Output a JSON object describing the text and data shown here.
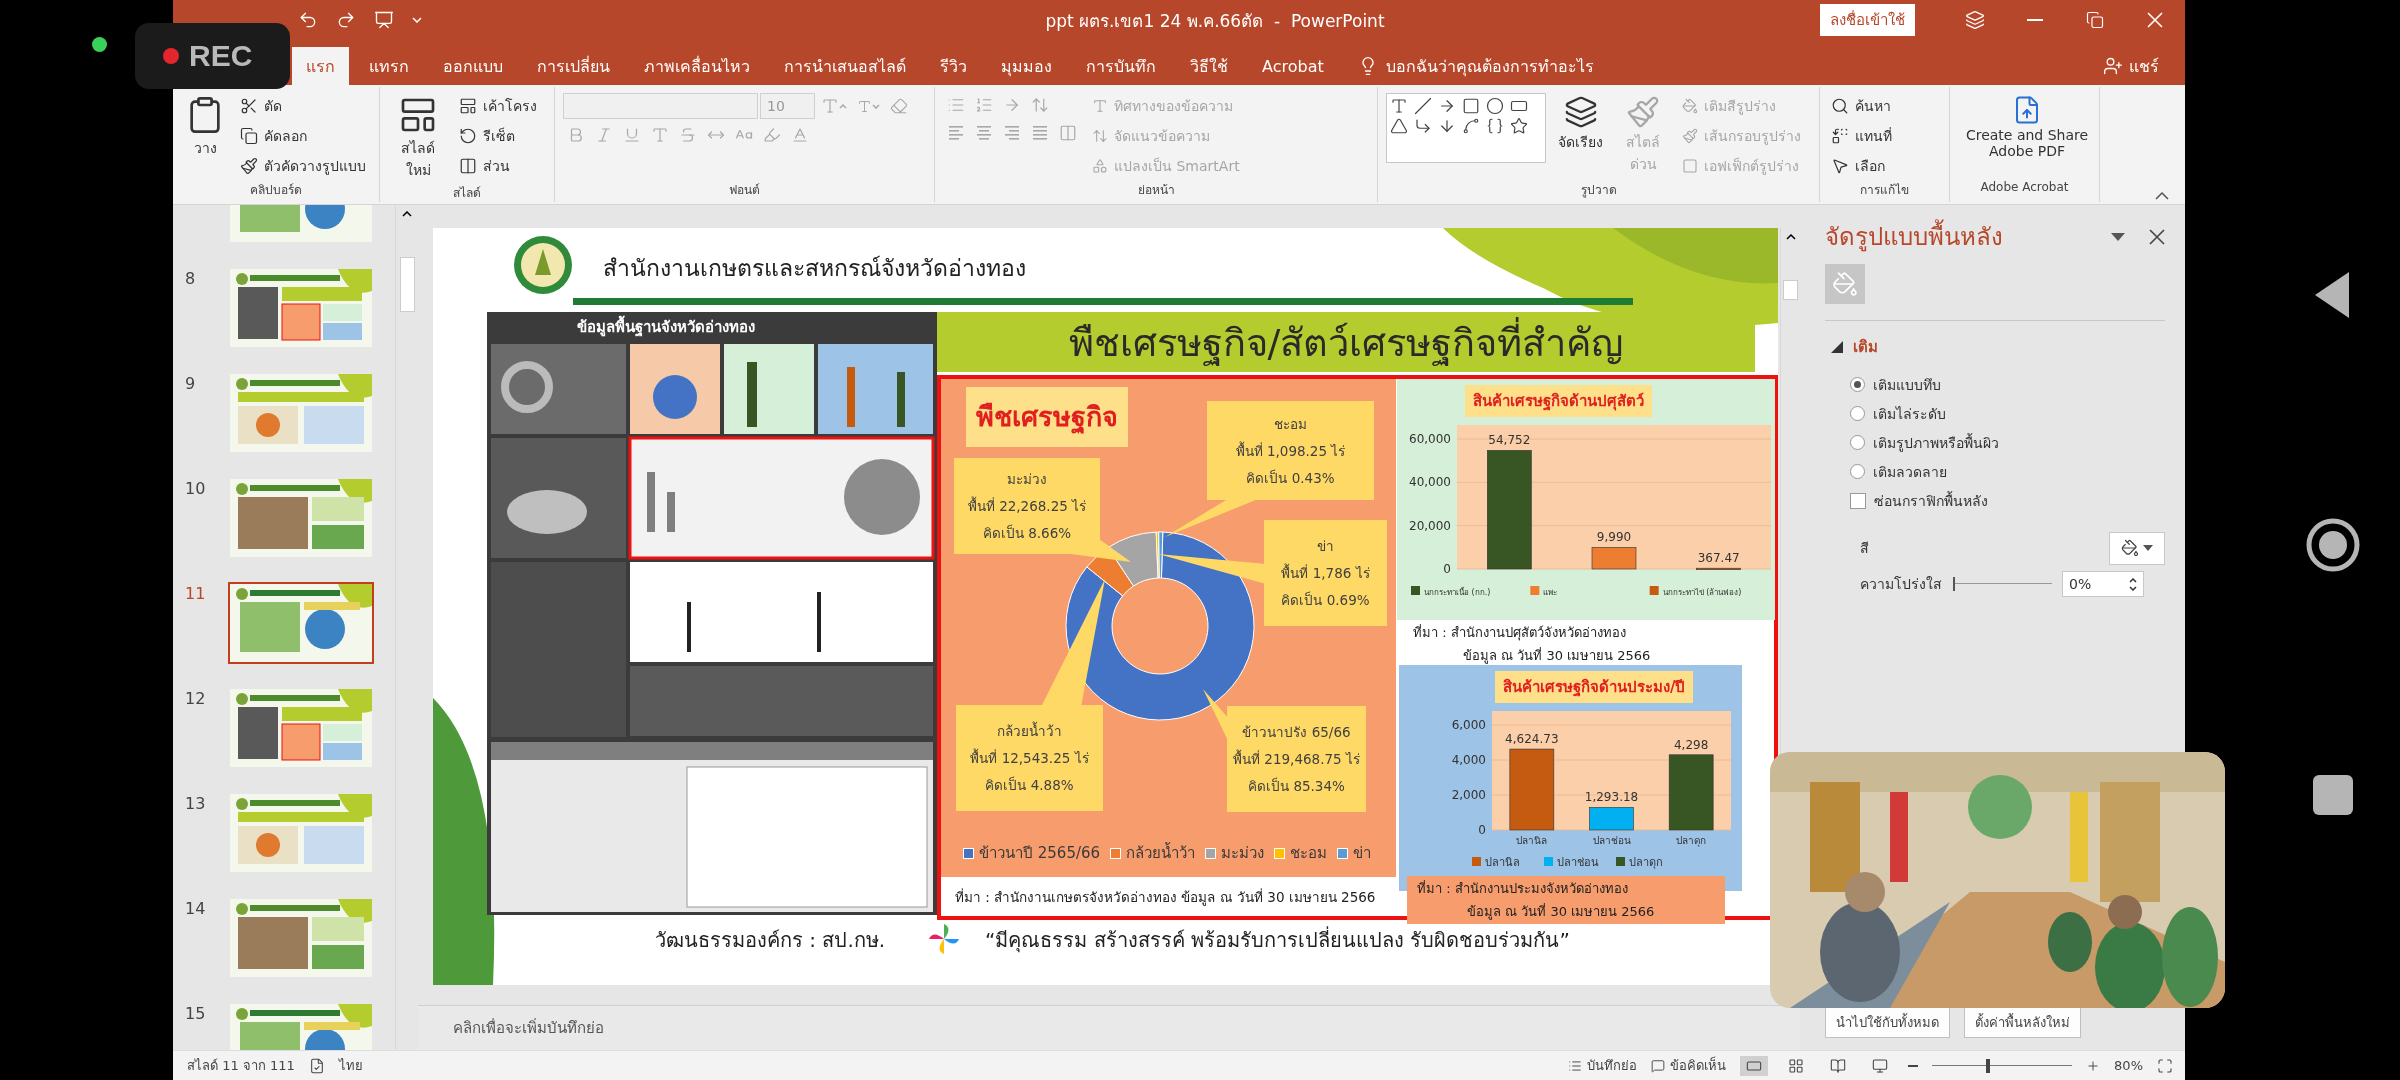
{
  "phone": {
    "recording_label": "REC"
  },
  "window": {
    "title": "ppt ผตร.เขต1 24 พ.ค.66ตัด  -  PowerPoint",
    "sign_in": "ลงชื่อเข้าใช้"
  },
  "tabs": [
    {
      "label": "แรก",
      "selected": true
    },
    {
      "label": "แทรก",
      "selected": false
    },
    {
      "label": "ออกแบบ",
      "selected": false
    },
    {
      "label": "การเปลี่ยน",
      "selected": false
    },
    {
      "label": "ภาพเคลื่อนไหว",
      "selected": false
    },
    {
      "label": "การนำเสนอสไลด์",
      "selected": false
    },
    {
      "label": "รีวิว",
      "selected": false
    },
    {
      "label": "มุมมอง",
      "selected": false
    },
    {
      "label": "การบันทึก",
      "selected": false
    },
    {
      "label": "วิธีใช้",
      "selected": false
    },
    {
      "label": "Acrobat",
      "selected": false
    }
  ],
  "tell_me": "บอกฉันว่าคุณต้องการทำอะไร",
  "share": "แชร์",
  "ribbon": {
    "clipboard": {
      "label": "คลิปบอร์ด",
      "paste": "วาง",
      "cut": "ตัด",
      "copy": "คัดลอก",
      "format_painter": "ตัวคัดวางรูปแบบ"
    },
    "slides": {
      "label": "สไลด์",
      "new_slide": "สไลด์ใหม่",
      "layout": "เค้าโครง",
      "reset": "รีเซ็ต",
      "section": "ส่วน"
    },
    "font": {
      "label": "ฟอนต์",
      "size": "10",
      "disabled": true
    },
    "paragraph": {
      "label": "ย่อหน้า",
      "disabled": true,
      "text_tools": [
        "ทิศทางของข้อความ",
        "จัดแนวข้อความ",
        "แปลงเป็น SmartArt"
      ]
    },
    "drawing": {
      "label": "รูปวาด",
      "arrange": "จัดเรียง",
      "quick_styles": {
        "label": "สไตล์ด่วน",
        "disabled": true
      },
      "shape_tools": [
        {
          "label": "เติมสีรูปร่าง",
          "disabled": true
        },
        {
          "label": "เส้นกรอบรูปร่าง",
          "disabled": true
        },
        {
          "label": "เอฟเฟ็กต์รูปร่าง",
          "disabled": true
        }
      ]
    },
    "editing": {
      "label": "การแก้ไข",
      "find": "ค้นหา",
      "replace": "แทนที่",
      "select": "เลือก"
    },
    "acrobat": {
      "label": "Adobe Acrobat",
      "create": "Create and Share Adobe PDF"
    }
  },
  "thumbnails": [
    {
      "selected": false
    },
    {
      "number": "8",
      "selected": false
    },
    {
      "number": "9",
      "selected": false
    },
    {
      "number": "10",
      "selected": false
    },
    {
      "number": "11",
      "selected": true
    },
    {
      "number": "12",
      "selected": false
    },
    {
      "number": "13",
      "selected": false
    },
    {
      "number": "14",
      "selected": false
    },
    {
      "number": "15",
      "selected": false
    }
  ],
  "slide": {
    "org_name": "สำนักงานเกษตรและสหกรณ์จังหวัดอ่างทอง",
    "infographic_title": "ข้อมูลพื้นฐานจังหวัดอ่างทอง",
    "title": "พืชเศรษฐกิจ/สัตว์เศรษฐกิจที่สำคัญ",
    "crops": {
      "title": "พืชเศรษฐกิจ",
      "callouts": [
        {
          "lines": [
            "ชะอม",
            "พื้นที่ 1,098.25 ไร่",
            "คิดเป็น 0.43%"
          ]
        },
        {
          "lines": [
            "มะม่วง",
            "พื้นที่ 22,268.25 ไร่",
            "คิดเป็น 8.66%"
          ]
        },
        {
          "lines": [
            "ข่า",
            "พื้นที่ 1,786 ไร่",
            "คิดเป็น  0.69%"
          ]
        },
        {
          "lines": [
            "กล้วยน้ำว้า",
            "พื้นที่ 12,543.25 ไร่",
            "คิดเป็น 4.88%"
          ]
        },
        {
          "lines": [
            "ข้าวนาปรัง 65/66",
            "พื้นที่ 219,468.75 ไร่",
            "คิดเป็น 85.34%"
          ]
        }
      ],
      "chart_data": {
        "type": "donut",
        "categories": [
          "ข้าวนาปี 2565/66",
          "กล้วยน้ำว้า",
          "มะม่วง",
          "ชะอม",
          "ข่า"
        ],
        "values": [
          85.34,
          4.88,
          8.66,
          0.43,
          0.69
        ],
        "colors": [
          "#4472c4",
          "#ed7d31",
          "#a5a5a5",
          "#ffc000",
          "#5b9bd5"
        ],
        "legend": "bottom"
      },
      "source": "ที่มา : สำนักงานเกษตรจังหวัดอ่างทอง ข้อมูล ณ วันที่ 30 เมษายน 2566"
    },
    "livestock": {
      "title": "สินค้าเศรษฐกิจด้านปศุสัตว์",
      "chart_data": {
        "type": "bar",
        "ylim": [
          0,
          60000
        ],
        "yticks": [
          0,
          {
            "value": 20000,
            "label": "20,000"
          },
          {
            "value": 40000,
            "label": "40,000"
          },
          {
            "value": 60000,
            "label": "60,000"
          }
        ],
        "value_labels": [
          [
            "54,752"
          ],
          [
            "9,990"
          ],
          [
            "367.47"
          ]
        ],
        "legend": "bottom",
        "series": [
          {
            "name": "นกกระทาเนื้อ (กก.)",
            "color": "#375623",
            "values": [
              54752
            ]
          },
          {
            "name": "แพะ",
            "color": "#ed7d31",
            "values": [
              9990
            ]
          },
          {
            "name": "นกกระทาไข่ (ล้านฟอง)",
            "color": "#c55a11",
            "values": [
              367.47
            ]
          }
        ]
      },
      "source": [
        "ที่มา : สำนักงานปศุสัตว์จังหวัดอ่างทอง",
        "ข้อมูล ณ วันที่ 30 เมษายน 2566"
      ]
    },
    "fishery": {
      "title": "สินค้าเศรษฐกิจด้านประมง/ปี",
      "chart_data": {
        "type": "bar",
        "categories": [
          "ปลานิล",
          "ปลาช่อน",
          "ปลาดุก"
        ],
        "ylim": [
          0,
          6000
        ],
        "yticks": [
          0,
          {
            "value": 2000,
            "label": "2,000"
          },
          {
            "value": 4000,
            "label": "4,000"
          },
          {
            "value": 6000,
            "label": "6,000"
          }
        ],
        "value_labels": [
          [
            "4,624.73",
            null,
            null
          ],
          [
            null,
            "1,293.18",
            null
          ],
          [
            null,
            null,
            "4,298"
          ]
        ],
        "legend": "bottom",
        "series": [
          {
            "name": "ปลานิล",
            "color": "#c55a11",
            "values": [
              4624.73,
              null,
              null
            ]
          },
          {
            "name": "ปลาช่อน",
            "color": "#00b0f0",
            "values": [
              null,
              1293.18,
              null
            ]
          },
          {
            "name": "ปลาดุก",
            "color": "#375623",
            "values": [
              null,
              null,
              4298
            ]
          }
        ]
      },
      "source": [
        "ที่มา : สำนักงานประมงจังหวัดอ่างทอง",
        "ข้อมูล ณ วันที่ 30 เมษายน 2566"
      ]
    },
    "footer_label": "วัฒนธรรมองค์กร : สป.กษ.",
    "footer_quote": "“มีคุณธรรม สร้างสรรค์ พร้อมรับการเปลี่ยนแปลง รับผิดชอบร่วมกัน”"
  },
  "notes": {
    "placeholder": "คลิกเพื่อจะเพิ่มบันทึกย่อ"
  },
  "format_pane": {
    "title": "จัดรูปแบบพื้นหลัง",
    "section": {
      "label": "เติม",
      "expanded": true
    },
    "fill_options": [
      {
        "label": "เติมแบบทึบ",
        "selected": true
      },
      {
        "label": "เติมไล่ระดับ",
        "selected": false
      },
      {
        "label": "เติมรูปภาพหรือพื้นผิว",
        "selected": false
      },
      {
        "label": "เติมลวดลาย",
        "selected": false
      }
    ],
    "hide_graphics": {
      "label": "ซ่อนกราฟิกพื้นหลัง",
      "checked": false
    },
    "color_label": "สี",
    "transparency": {
      "label": "ความโปร่งใส",
      "level": 0,
      "value": "0%"
    },
    "buttons": [
      "นำไปใช้กับทั้งหมด",
      "ตั้งค่าพื้นหลังใหม่"
    ]
  },
  "status_bar": {
    "slide_counter": "สไลด์ 11 จาก 111",
    "language": "ไทย",
    "notes": "บันทึกย่อ",
    "comments": "ข้อคิดเห็น",
    "views": [
      {
        "kind": "normal",
        "selected": true
      },
      {
        "kind": "sorter",
        "selected": false
      },
      {
        "kind": "reading",
        "selected": false
      },
      {
        "kind": "slideshow",
        "selected": false
      }
    ],
    "zoom": {
      "level": 0.4,
      "value": "80%"
    }
  }
}
